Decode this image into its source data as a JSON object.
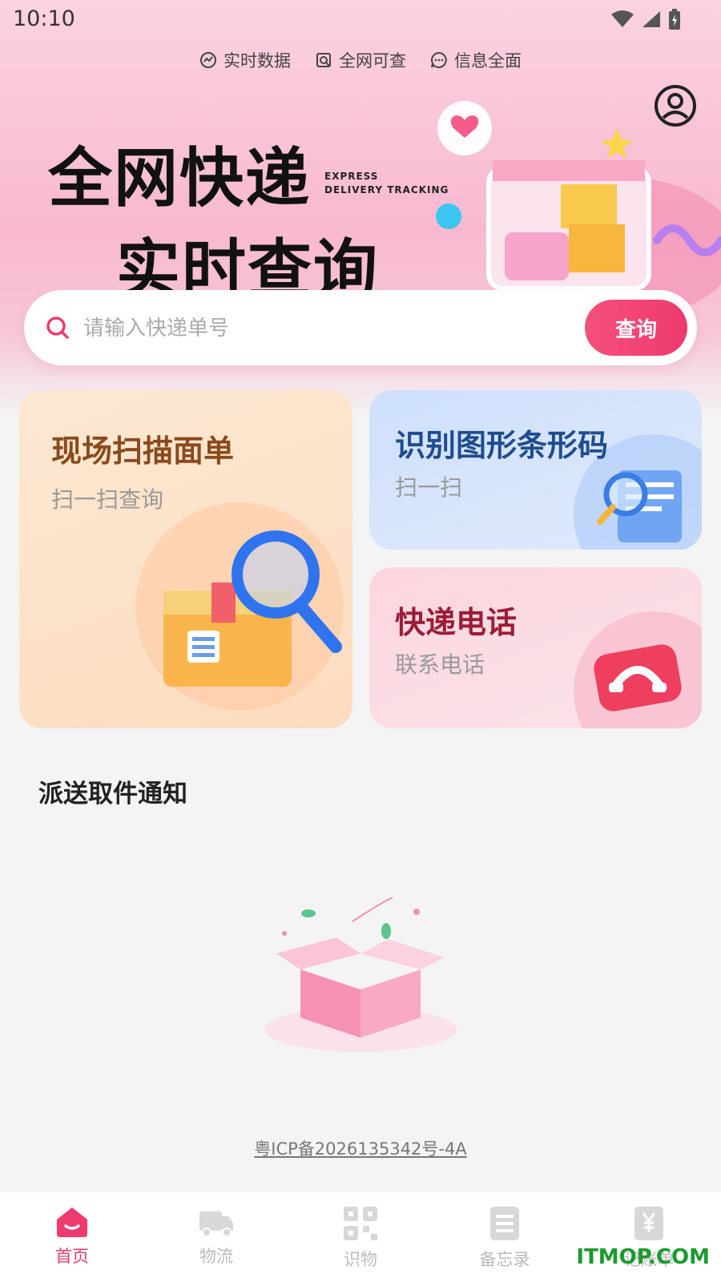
{
  "status_bar": {
    "time": "10:10"
  },
  "features": [
    {
      "label": "实时数据",
      "icon": "chart-icon"
    },
    {
      "label": "全网可查",
      "icon": "search-doc-icon"
    },
    {
      "label": "信息全面",
      "icon": "chat-icon"
    }
  ],
  "hero": {
    "title_line_1": "全网快递",
    "title_line_2": "实时查询",
    "subtitle_line_1": "EXPRESS",
    "subtitle_line_2": "DELIVERY TRACKING"
  },
  "search": {
    "placeholder": "请输入快递单号",
    "button_label": "查询"
  },
  "cards": {
    "scan": {
      "title": "现场扫描面单",
      "subtitle": "扫一扫查询"
    },
    "barcode": {
      "title": "识别图形条形码",
      "subtitle": "扫一扫"
    },
    "phone": {
      "title": "快递电话",
      "subtitle": "联系电话"
    }
  },
  "notice": {
    "title": "派送取件通知"
  },
  "footer": {
    "icp": "粤ICP备2026135342号-4A"
  },
  "tabs": [
    {
      "label": "首页",
      "active": true
    },
    {
      "label": "物流",
      "active": false
    },
    {
      "label": "识物",
      "active": false
    },
    {
      "label": "备忘录",
      "active": false
    },
    {
      "label": "记账单",
      "active": false
    }
  ],
  "watermark": "ITMOP.COM",
  "colors": {
    "accent": "#ee3a6e",
    "tab_inactive": "#bbbbbb"
  }
}
